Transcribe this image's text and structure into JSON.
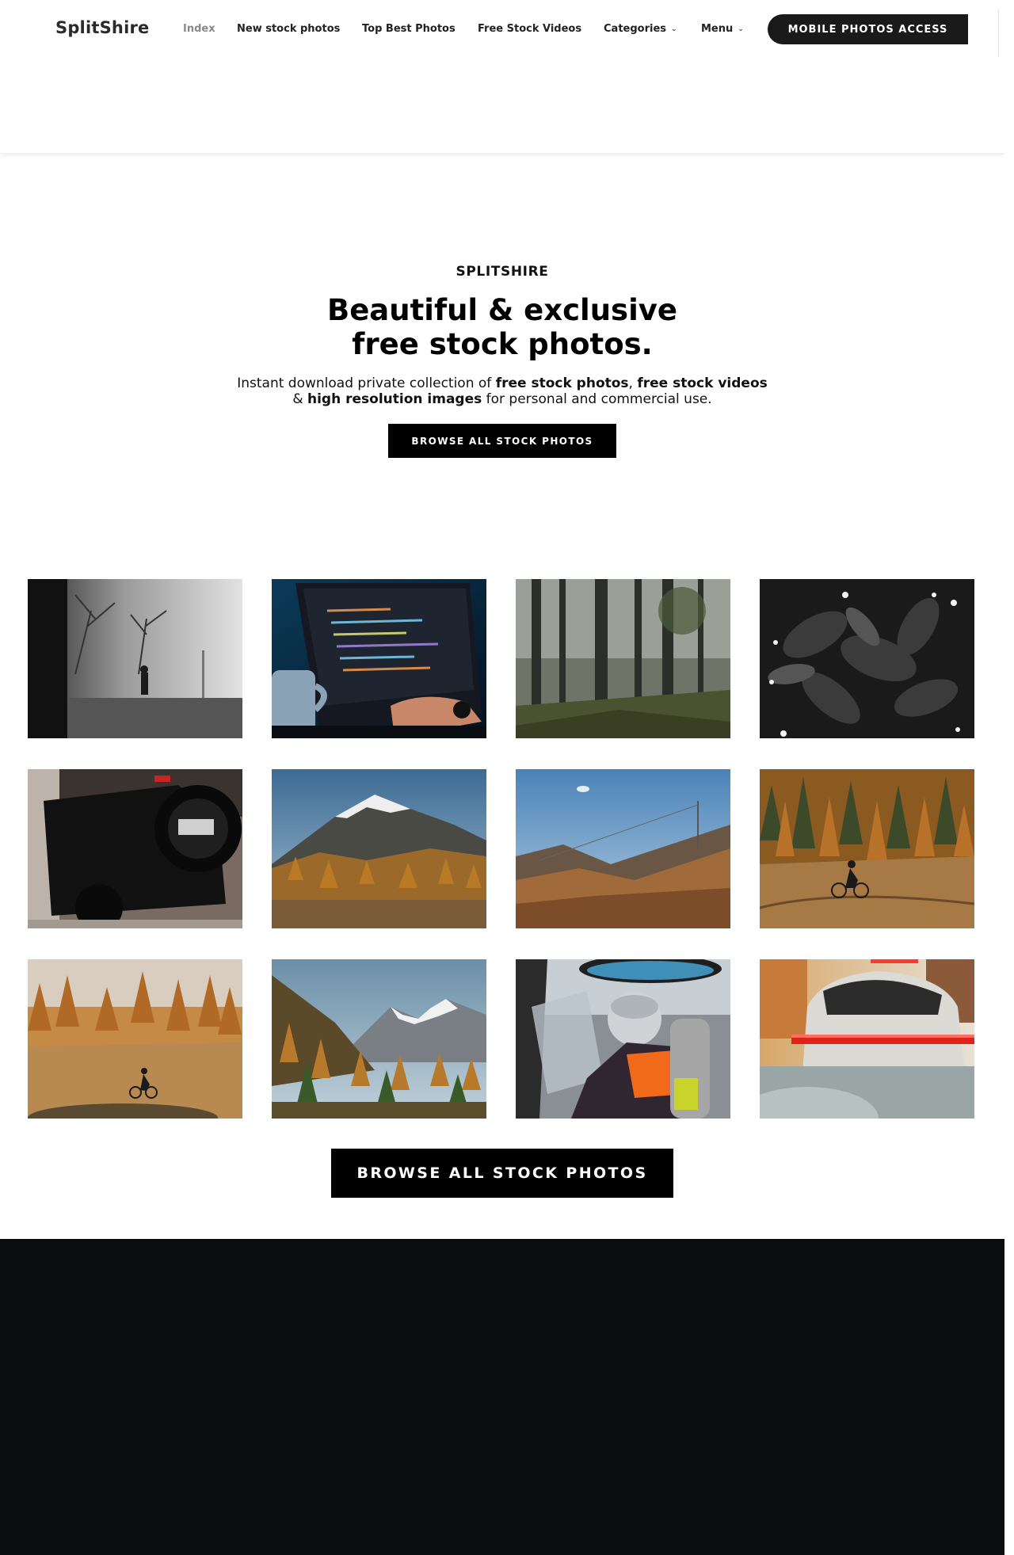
{
  "header": {
    "logo": "SplitShire",
    "nav": [
      {
        "label": "Index",
        "active": true,
        "dropdown": false
      },
      {
        "label": "New stock photos",
        "active": false,
        "dropdown": false
      },
      {
        "label": "Top Best Photos",
        "active": false,
        "dropdown": false
      },
      {
        "label": "Free Stock Videos",
        "active": false,
        "dropdown": false
      },
      {
        "label": "Categories",
        "active": false,
        "dropdown": true
      },
      {
        "label": "Menu",
        "active": false,
        "dropdown": true
      }
    ],
    "cta_label": "MOBILE PHOTOS ACCESS",
    "caret_glyph": "⌄"
  },
  "hero": {
    "eyebrow": "SPLITSHIRE",
    "title_line1": "Beautiful & exclusive",
    "title_line2": "free stock photos.",
    "desc_part1": "Instant download private collection of ",
    "desc_bold1": "free stock photos",
    "desc_part2": ", ",
    "desc_bold2": "free stock videos",
    "desc_part3": "& ",
    "desc_bold3": "high resolution images",
    "desc_part4": " for personal and commercial use.",
    "button_label": "BROWSE ALL STOCK PHOTOS"
  },
  "gallery": {
    "photos": [
      {
        "name": "photo-foggy-street-walker"
      },
      {
        "name": "photo-laptop-code-coffee"
      },
      {
        "name": "photo-misty-forest"
      },
      {
        "name": "photo-dark-leaves-flowers"
      },
      {
        "name": "photo-black-jeep-spare-tire"
      },
      {
        "name": "photo-snowy-mountain-autumn"
      },
      {
        "name": "photo-alpine-slope-cable"
      },
      {
        "name": "photo-cyclist-larch-forest"
      },
      {
        "name": "photo-cyclist-autumn-meadow"
      },
      {
        "name": "photo-alpine-peaks-forest"
      },
      {
        "name": "photo-helicopter-pilot"
      },
      {
        "name": "photo-porsche-tail-lights"
      }
    ]
  },
  "bottom_button_label": "BROWSE ALL STOCK PHOTOS",
  "colors": {
    "accent": "#000000",
    "footer": "#0b0c0f",
    "nav_active": "#8a8a8a"
  }
}
